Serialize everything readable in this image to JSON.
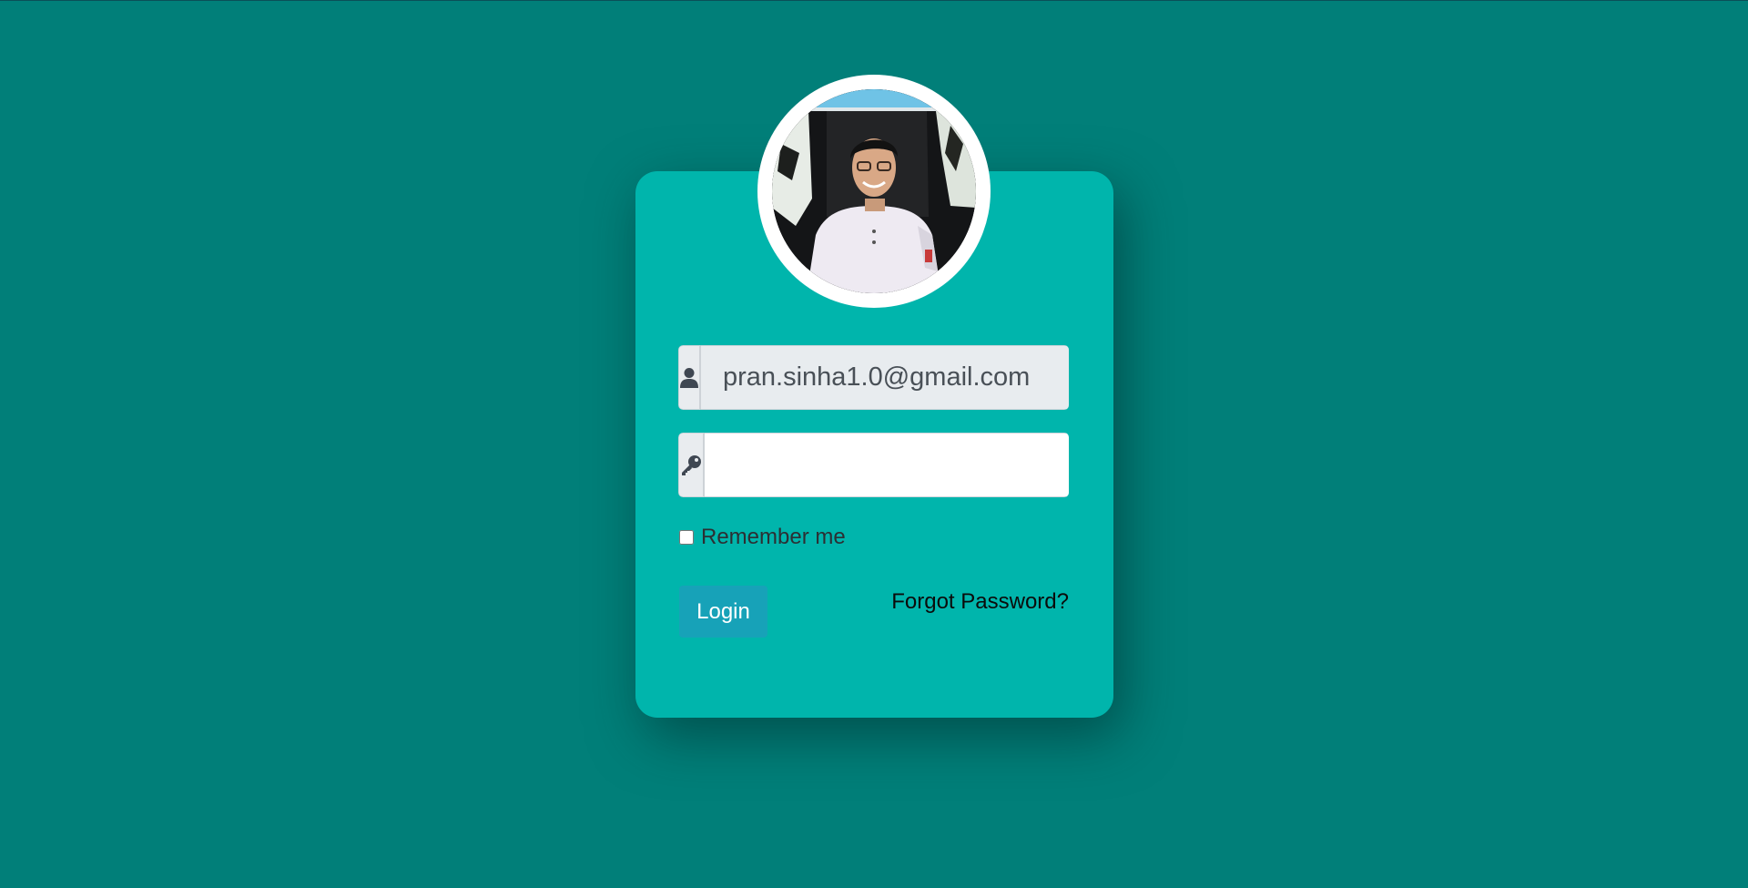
{
  "login_form": {
    "email_value": "pran.sinha1.0@gmail.com",
    "password_value": "",
    "remember_label": "Remember me",
    "remember_checked": false,
    "login_label": "Login",
    "forgot_label": "Forgot Password?"
  },
  "icons": {
    "username": "user-icon",
    "password": "key-icon"
  },
  "colors": {
    "page_background": "#017f79",
    "card_background": "#00b5ac",
    "login_button": "#17a2b8"
  }
}
